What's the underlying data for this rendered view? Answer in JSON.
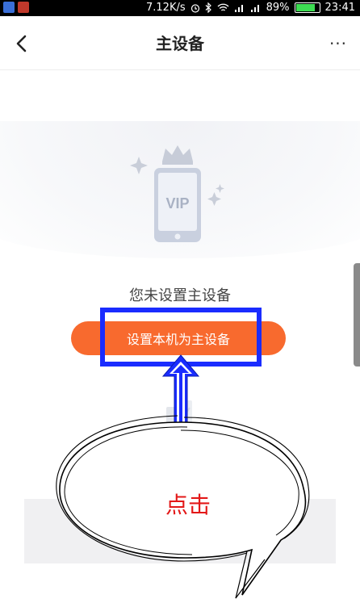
{
  "status_bar": {
    "network_speed": "7.12K/s",
    "battery_percent": "89%",
    "battery_level": 0.89,
    "time": "23:41",
    "icons": [
      "app-icon-shield",
      "app-icon-avatar",
      "alarm-icon",
      "bluetooth-icon",
      "wifi-icon",
      "signal-icon",
      "signal-icon"
    ]
  },
  "nav": {
    "back_icon": "chevron-left-icon",
    "title": "主设备",
    "more_label": "···"
  },
  "hero": {
    "illustration": "phone-vip-crown",
    "badge_text": "VIP"
  },
  "main": {
    "empty_text": "您未设置主设备",
    "set_button_label": "设置本机为主设备"
  },
  "annotation": {
    "bubble_text": "点击",
    "highlight_color": "#1a2cff",
    "arrow_color": "#1a2cff",
    "text_color": "#e31818"
  },
  "colors": {
    "accent": "#f86a2e",
    "background": "#ffffff"
  }
}
